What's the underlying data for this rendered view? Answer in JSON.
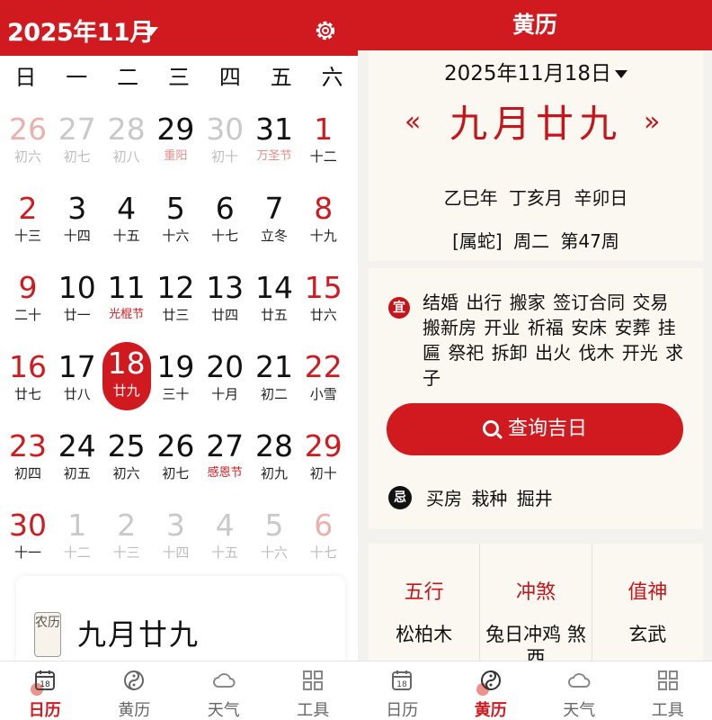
{
  "left": {
    "header": {
      "title": "2025年11月"
    },
    "weekdays": [
      "日",
      "一",
      "二",
      "三",
      "四",
      "五",
      "六"
    ],
    "days": [
      {
        "d": "26",
        "l": "初六",
        "type": "dimwk"
      },
      {
        "d": "27",
        "l": "初七",
        "type": "dim"
      },
      {
        "d": "28",
        "l": "初八",
        "type": "dim"
      },
      {
        "d": "29",
        "l": "重阳",
        "type": "dimfest"
      },
      {
        "d": "30",
        "l": "初十",
        "type": "dim"
      },
      {
        "d": "31",
        "l": "万圣节",
        "type": "dimfest"
      },
      {
        "d": "1",
        "l": "十二",
        "type": "wk"
      },
      {
        "d": "2",
        "l": "十三",
        "type": "wk"
      },
      {
        "d": "3",
        "l": "十四",
        "type": ""
      },
      {
        "d": "4",
        "l": "十五",
        "type": ""
      },
      {
        "d": "5",
        "l": "十六",
        "type": ""
      },
      {
        "d": "6",
        "l": "十七",
        "type": ""
      },
      {
        "d": "7",
        "l": "立冬",
        "type": ""
      },
      {
        "d": "8",
        "l": "十九",
        "type": "wk"
      },
      {
        "d": "9",
        "l": "二十",
        "type": "wk"
      },
      {
        "d": "10",
        "l": "廿一",
        "type": ""
      },
      {
        "d": "11",
        "l": "光棍节",
        "type": "fest"
      },
      {
        "d": "12",
        "l": "廿三",
        "type": ""
      },
      {
        "d": "13",
        "l": "廿四",
        "type": ""
      },
      {
        "d": "14",
        "l": "廿五",
        "type": ""
      },
      {
        "d": "15",
        "l": "廿六",
        "type": "wk"
      },
      {
        "d": "16",
        "l": "廿七",
        "type": "wk"
      },
      {
        "d": "17",
        "l": "廿八",
        "type": ""
      },
      {
        "d": "18",
        "l": "廿九",
        "type": "sel"
      },
      {
        "d": "19",
        "l": "三十",
        "type": ""
      },
      {
        "d": "20",
        "l": "十月",
        "type": ""
      },
      {
        "d": "21",
        "l": "初二",
        "type": ""
      },
      {
        "d": "22",
        "l": "小雪",
        "type": "wk"
      },
      {
        "d": "23",
        "l": "初四",
        "type": "wk"
      },
      {
        "d": "24",
        "l": "初五",
        "type": ""
      },
      {
        "d": "25",
        "l": "初六",
        "type": ""
      },
      {
        "d": "26",
        "l": "初七",
        "type": ""
      },
      {
        "d": "27",
        "l": "感恩节",
        "type": "fest"
      },
      {
        "d": "28",
        "l": "初九",
        "type": ""
      },
      {
        "d": "29",
        "l": "初十",
        "type": "wk"
      },
      {
        "d": "30",
        "l": "十一",
        "type": "wk"
      },
      {
        "d": "1",
        "l": "十二",
        "type": "dim"
      },
      {
        "d": "2",
        "l": "十三",
        "type": "dim"
      },
      {
        "d": "3",
        "l": "十四",
        "type": "dim"
      },
      {
        "d": "4",
        "l": "十五",
        "type": "dim"
      },
      {
        "d": "5",
        "l": "十六",
        "type": "dim"
      },
      {
        "d": "6",
        "l": "十七",
        "type": "dimwk"
      }
    ],
    "card": {
      "stamp": "农历",
      "lunar": "九月廿九"
    }
  },
  "right": {
    "header": {
      "title": "黄历"
    },
    "date": "2025年11月18日",
    "lunar": "九月廿九",
    "ganzhi": "乙巳年 丁亥月 辛卯日",
    "zodiac_week": "[属蛇] 周二 第47周",
    "yi_label": "宜",
    "yi_items": "结婚 出行 搬家 签订合同 交易 搬新房 开业 祈福 安床 安葬 挂匾 祭祀 拆卸 出火 伐木 开光 求子",
    "query_button": "查询吉日",
    "ji_label": "忌",
    "ji_items": "买房 栽种 掘井",
    "columns": [
      {
        "head": "五行",
        "value": "松柏木"
      },
      {
        "head": "冲煞",
        "value": "兔日冲鸡 煞西"
      },
      {
        "head": "值神",
        "value": "玄武"
      }
    ]
  },
  "tabs": [
    {
      "label": "日历",
      "icon": "calendar-icon"
    },
    {
      "label": "黄历",
      "icon": "yin-yang-icon"
    },
    {
      "label": "天气",
      "icon": "cloud-icon"
    },
    {
      "label": "工具",
      "icon": "grid-icon"
    }
  ],
  "colors": {
    "primary": "#d01a1f",
    "card_bg": "#fbf8f1"
  }
}
